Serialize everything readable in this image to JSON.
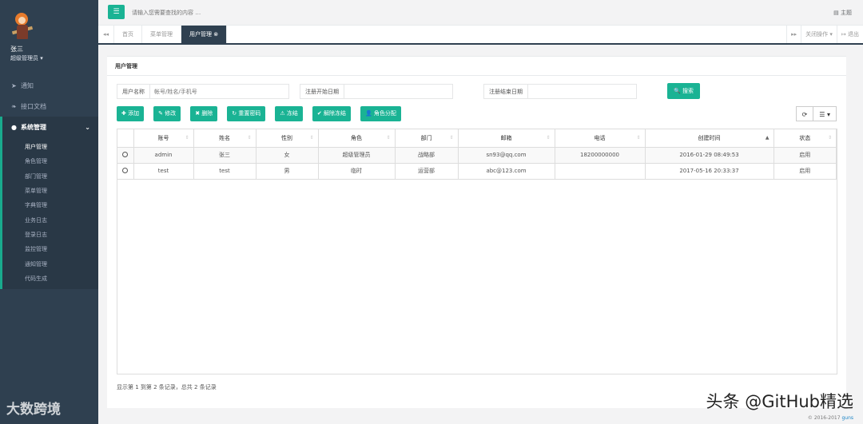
{
  "user": {
    "name": "张三",
    "role": "超级管理员 ▾"
  },
  "sidebar": {
    "items": [
      {
        "label": "通知"
      },
      {
        "label": "接口文档"
      },
      {
        "label": "系统管理",
        "chevron": "⌄"
      }
    ],
    "sub_items": [
      "用户管理",
      "角色管理",
      "部门管理",
      "菜单管理",
      "字典管理",
      "业务日志",
      "登录日志",
      "监控管理",
      "通知管理",
      "代码生成"
    ]
  },
  "topbar": {
    "search_placeholder": "请输入您需要查找的内容 …",
    "theme_label": "▤ 主题"
  },
  "tabs": {
    "left_arrow": "◂◂",
    "items": [
      {
        "label": "首页"
      },
      {
        "label": "菜单管理"
      },
      {
        "label": "用户管理 ⊗"
      }
    ],
    "right_arrow": "▸▸",
    "close_ops": "关闭操作 ▾",
    "logout": "↦ 退出"
  },
  "panel": {
    "title": "用户管理"
  },
  "filters": [
    {
      "label": "用户名称",
      "placeholder": "帐号/姓名/手机号"
    },
    {
      "label": "注册开始日期",
      "placeholder": ""
    },
    {
      "label": "注册结束日期",
      "placeholder": ""
    }
  ],
  "search_button": "🔍 搜索",
  "toolbar": [
    "✚ 添加",
    "✎ 修改",
    "✖ 删除",
    "↻ 重置密码",
    "⚠ 冻结",
    "✔ 解除冻结",
    "👤 角色分配"
  ],
  "tools_right": {
    "refresh": "⟳",
    "columns": "☰ ▾"
  },
  "table": {
    "columns": [
      "账号",
      "姓名",
      "性别",
      "角色",
      "部门",
      "邮箱",
      "电话",
      "创建时间",
      "状态"
    ],
    "rows": [
      [
        "admin",
        "张三",
        "女",
        "超级管理员",
        "战略部",
        "sn93@qq.com",
        "18200000000",
        "2016-01-29 08:49:53",
        "启用"
      ],
      [
        "test",
        "test",
        "男",
        "临时",
        "运营部",
        "abc@123.com",
        "",
        "2017-05-16 20:33:37",
        "启用"
      ]
    ]
  },
  "pagination_info": "显示第 1 到第 2 条记录，总共 2 条记录",
  "footer": {
    "copyright": "© 2016-2017",
    "link": "guns"
  },
  "watermark_left": "大数跨境",
  "watermark_right": "头条 @GitHub精选",
  "colors": {
    "sidebar": "#2f4050",
    "accent": "#1ab394"
  }
}
